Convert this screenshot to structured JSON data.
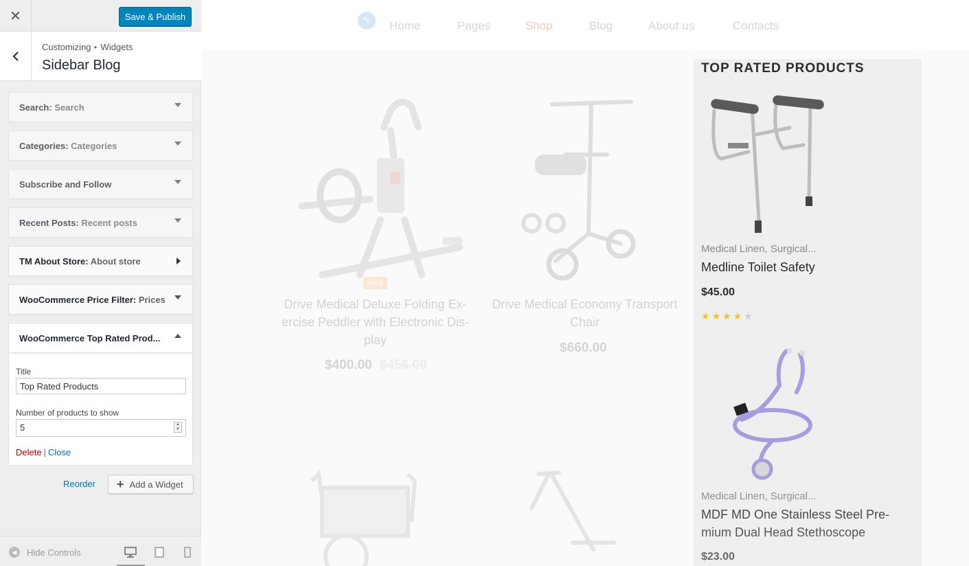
{
  "customizer": {
    "close_icon": "close-icon",
    "save_label": "Save & Publish",
    "breadcrumb": [
      "Customizing",
      "Widgets"
    ],
    "section_title": "Sidebar Blog",
    "widgets": [
      {
        "name": "Search:",
        "sub": "Search"
      },
      {
        "name": "Categories:",
        "sub": "Categories"
      },
      {
        "name": "Subscribe and Follow",
        "sub": ""
      },
      {
        "name": "Recent Posts:",
        "sub": "Recent posts"
      },
      {
        "name": "TM About Store:",
        "sub": "About store"
      },
      {
        "name": "WooCommerce Price Filter:",
        "sub": "Prices"
      },
      {
        "name": "WooCommerce Top Rated Prod...",
        "sub": ""
      }
    ],
    "form": {
      "title_label": "Title",
      "title_value": "Top Rated Products",
      "count_label": "Number of products to show",
      "count_value": "5",
      "delete_label": "Delete",
      "separator": "|",
      "close_label": "Close"
    },
    "reorder_label": "Reorder",
    "add_widget_label": "Add a Widget",
    "hide_controls_label": "Hide Controls",
    "devices": [
      "desktop-icon",
      "tablet-icon",
      "mobile-icon"
    ],
    "active_device": "desktop"
  },
  "preview": {
    "nav": [
      "Home",
      "Pages",
      "Shop",
      "Blog",
      "About us",
      "Contacts"
    ],
    "active_nav": "Shop",
    "products": [
      {
        "name": "Drive Medical Deluxe Folding Ex-ercise Peddler with Electronic Dis-play",
        "price": "$400.00",
        "old_price": "$456.00",
        "badge": "SALE"
      },
      {
        "name": "Drive Medical Economy Transport Chair",
        "price": "$660.00"
      }
    ],
    "top_rated": {
      "title": "TOP RATED PRODUCTS",
      "items": [
        {
          "category": "Medical Linen, Surgical...",
          "name": "Medline Toilet Safety",
          "price": "$45.00",
          "rating": 4.5
        },
        {
          "category": "Medical Linen, Surgical...",
          "name": "MDF MD One Stainless Steel Pre-mium Dual Head Stethoscope",
          "price": "$23.00"
        }
      ]
    }
  },
  "colors": {
    "primary_button": "#0085ba",
    "link": "#0073aa",
    "delete": "#aa0000",
    "star": "#f5c518"
  }
}
